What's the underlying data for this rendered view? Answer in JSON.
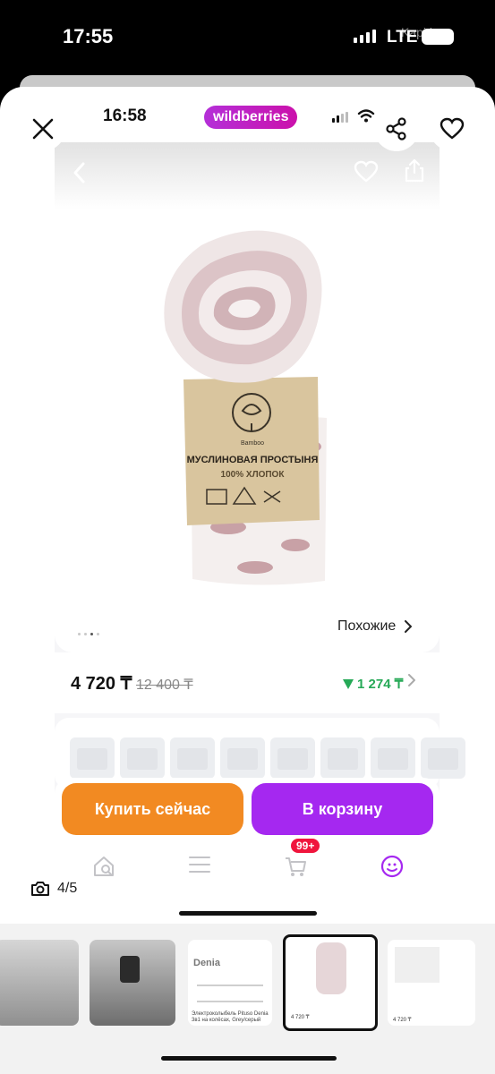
{
  "outer_status": {
    "time": "17:55",
    "network": "LTE",
    "watermark": "Kapi.kz"
  },
  "app_status": {
    "time": "16:58",
    "brand": "wildberries"
  },
  "product": {
    "label_line1": "МУСЛИНОВАЯ ПРОСТЫНЯ",
    "label_line2": "100% ХЛОПОК",
    "label_brand": "Bamboo",
    "image_index": 3,
    "image_count": 4,
    "similar_label": "Похожие"
  },
  "price": {
    "current": "4 720 ₸",
    "old": "12 400 ₸",
    "discount": "1 274 ₸"
  },
  "actions": {
    "buy_now": "Купить сейчас",
    "add_to_cart": "В корзину"
  },
  "tabbar": {
    "cart_badge": "99+"
  },
  "gallery": {
    "counter": "4/5",
    "thumb3_brand": "Denia",
    "thumb3_caption": "Электроколыбель Pituso Denia 3в1 на колёсах, Grey/серый",
    "thumb4_price": "4 720 ₸",
    "thumb5_price": "4 720 ₸"
  },
  "colors": {
    "wb_purple": "#a528f0",
    "buy_orange": "#f28a22",
    "discount_green": "#26a957",
    "badge_red": "#f0153d"
  },
  "icons": [
    "close-icon",
    "share-icon",
    "heart-icon",
    "back-icon",
    "chevron-right-icon",
    "home-search-icon",
    "menu-icon",
    "cart-icon",
    "profile-icon",
    "camera-icon"
  ]
}
